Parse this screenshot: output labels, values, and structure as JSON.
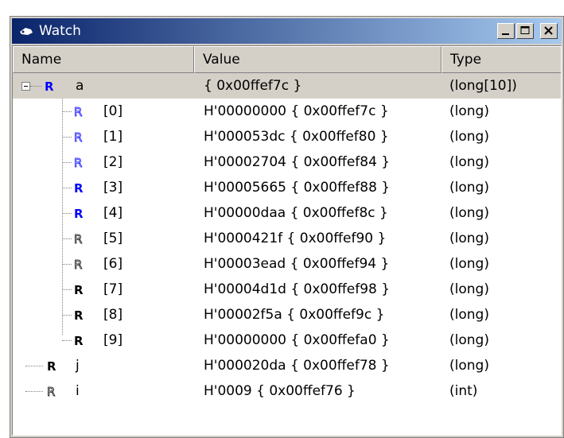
{
  "window": {
    "title": "Watch",
    "icon": "watch-icon"
  },
  "columns": {
    "name": "Name",
    "value": "Value",
    "type": "Type"
  },
  "rows": [
    {
      "name": "a",
      "value": "{ 0x00ffef7c }",
      "type": "(long[10])"
    },
    {
      "name": "[0]",
      "value": "H'00000000 { 0x00ffef7c }",
      "type": "(long)"
    },
    {
      "name": "[1]",
      "value": "H'000053dc { 0x00ffef80 }",
      "type": "(long)"
    },
    {
      "name": "[2]",
      "value": "H'00002704 { 0x00ffef84 }",
      "type": "(long)"
    },
    {
      "name": "[3]",
      "value": "H'00005665 { 0x00ffef88 }",
      "type": "(long)"
    },
    {
      "name": "[4]",
      "value": "H'00000daa { 0x00ffef8c }",
      "type": "(long)"
    },
    {
      "name": "[5]",
      "value": "H'0000421f { 0x00ffef90 }",
      "type": "(long)"
    },
    {
      "name": "[6]",
      "value": "H'00003ead { 0x00ffef94 }",
      "type": "(long)"
    },
    {
      "name": "[7]",
      "value": "H'00004d1d { 0x00ffef98 }",
      "type": "(long)"
    },
    {
      "name": "[8]",
      "value": "H'00002f5a { 0x00ffef9c }",
      "type": "(long)"
    },
    {
      "name": "[9]",
      "value": "H'00000000 { 0x00ffefa0 }",
      "type": "(long)"
    },
    {
      "name": "j",
      "value": "H'000020da { 0x00ffef78 }",
      "type": "(long)"
    },
    {
      "name": "i",
      "value": "H'0009 { 0x00ffef76 }",
      "type": "(int)"
    }
  ]
}
